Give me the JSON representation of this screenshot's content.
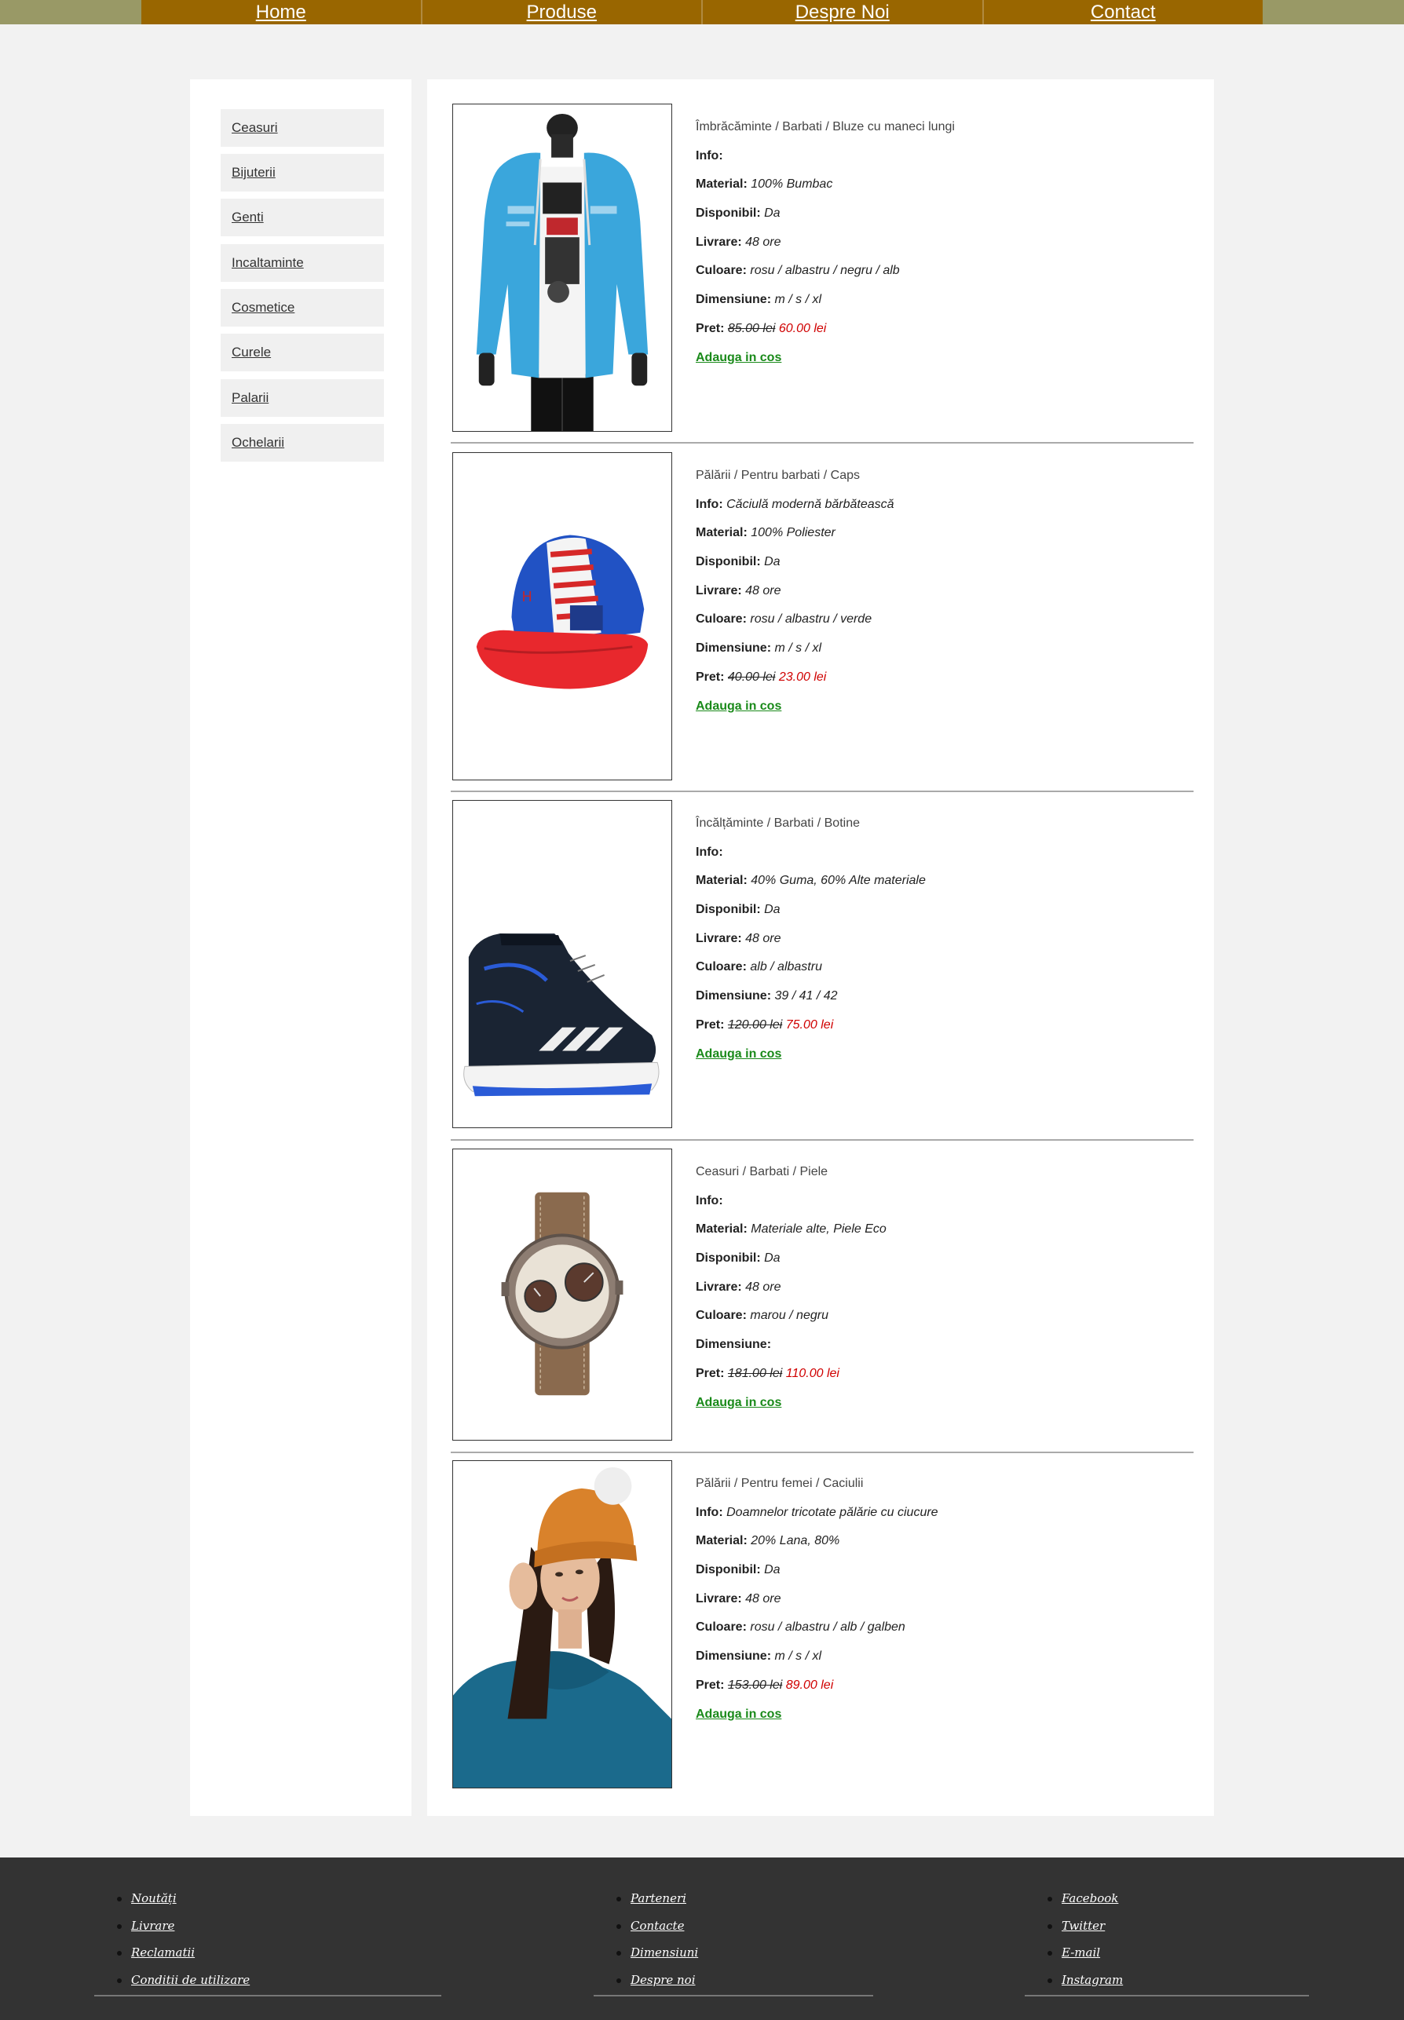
{
  "nav": {
    "items": [
      "Home",
      "Produse",
      "Despre Noi",
      "Contact"
    ]
  },
  "sidebar": {
    "items": [
      "Ceasuri",
      "Bijuterii",
      "Genti",
      "Incaltaminte",
      "Cosmetice",
      "Curele",
      "Palarii",
      "Ochelarii"
    ]
  },
  "labels": {
    "info": "Info:",
    "material": "Material:",
    "disponibil": "Disponibil:",
    "livrare": "Livrare:",
    "culoare": "Culoare:",
    "dimensiune": "Dimensiune:",
    "pret": "Pret:",
    "add_to_cart": "Adauga in cos"
  },
  "products": [
    {
      "category": "Îmbrăcăminte / Barbati / Bluze cu maneci lungi",
      "info": "",
      "material": "100% Bumbac",
      "disponibil": "Da",
      "livrare": "48 ore",
      "culoare": "rosu / albastru / negru / alb",
      "dimensiune": "m / s / xl",
      "old_price": "85.00 lei",
      "new_price": "60.00 lei",
      "image_icon": "hoodie-image"
    },
    {
      "category": "Pălării / Pentru barbati / Caps",
      "info": "Căciulă modernă bărbătească",
      "material": "100% Poliester",
      "disponibil": "Da",
      "livrare": "48 ore",
      "culoare": "rosu / albastru / verde",
      "dimensiune": "m / s / xl",
      "old_price": "40.00 lei",
      "new_price": "23.00 lei",
      "image_icon": "cap-image"
    },
    {
      "category": "Încălțăminte / Barbati / Botine",
      "info": "",
      "material": "40% Guma, 60% Alte materiale",
      "disponibil": "Da",
      "livrare": "48 ore",
      "culoare": "alb / albastru",
      "dimensiune": "39 / 41 / 42",
      "old_price": "120.00 lei",
      "new_price": "75.00 lei",
      "image_icon": "sneaker-image"
    },
    {
      "category": "Ceasuri / Barbati / Piele",
      "info": "",
      "material": "Materiale alte, Piele Eco",
      "disponibil": "Da",
      "livrare": "48 ore",
      "culoare": "marou / negru",
      "dimensiune": "",
      "old_price": "181.00 lei",
      "new_price": "110.00 lei",
      "image_icon": "watch-image"
    },
    {
      "category": "Pălării / Pentru femei / Caciulii",
      "info": "Doamnelor tricotate pălărie cu ciucure",
      "material": "20% Lana, 80%",
      "disponibil": "Da",
      "livrare": "48 ore",
      "culoare": "rosu / albastru / alb / galben",
      "dimensiune": "m / s / xl",
      "old_price": "153.00 lei",
      "new_price": "89.00 lei",
      "image_icon": "beanie-image"
    }
  ],
  "footer": {
    "col1": [
      "Noutăți",
      "Livrare",
      "Reclamatii",
      "Conditii de utilizare"
    ],
    "col2": [
      "Parteneri",
      "Contacte",
      "Dimensiuni",
      "Despre noi"
    ],
    "col3": [
      "Facebook",
      "Twitter",
      "E-mail",
      "Instagram"
    ]
  },
  "colors": {
    "topbar": "#999966",
    "nav": "#996600",
    "price_new": "#d00000",
    "cart_link": "#1a8a1a",
    "footer": "#333333"
  }
}
